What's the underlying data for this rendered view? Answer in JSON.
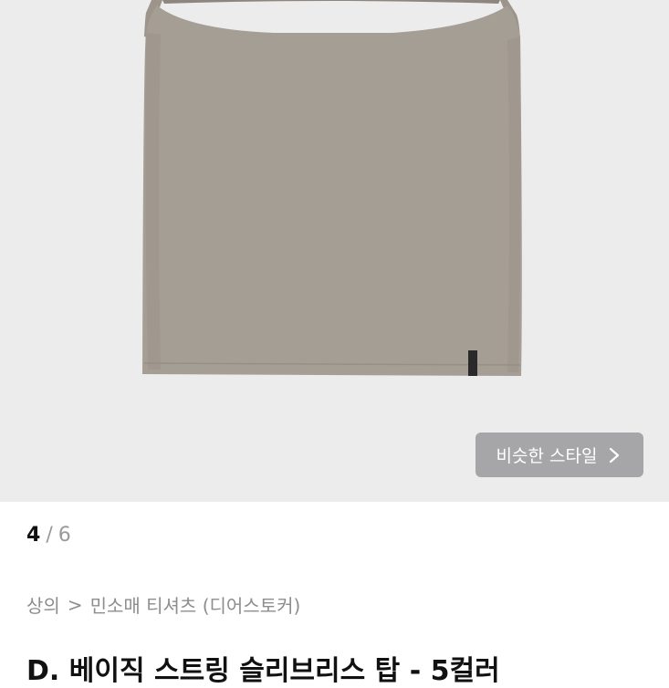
{
  "gallery": {
    "product_image": "sleeveless-tank-top-image",
    "similar_style_label": "비슷한 스타일",
    "chevron_icon": "chevron-right-icon"
  },
  "pager": {
    "current": "4",
    "separator": "/",
    "total": "6"
  },
  "breadcrumb": {
    "category": "상의",
    "separator": ">",
    "subcategory": "민소매 티셔츠 (디어스토커)"
  },
  "product": {
    "title": "D. 베이직 스트링 슬리브리스 탑 - 5컬러"
  }
}
